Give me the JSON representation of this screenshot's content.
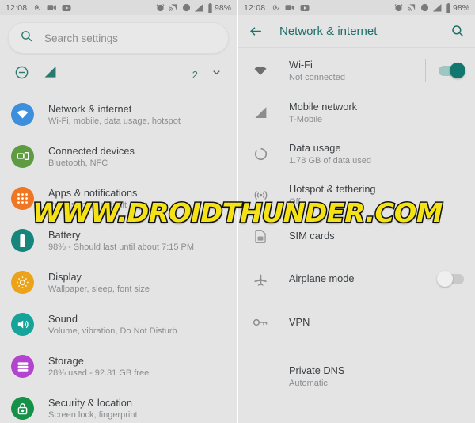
{
  "statusbar": {
    "time": "12:08",
    "battery_percent": "98%",
    "left_icons": [
      "screen-record-icon",
      "video-camera-icon",
      "youtube-icon"
    ],
    "right_icons": [
      "alarm-icon",
      "cast-icon",
      "do-not-disturb-icon",
      "signal-icon",
      "battery-icon"
    ]
  },
  "left": {
    "search": {
      "placeholder": "Search settings",
      "icon": "search-icon"
    },
    "quick": {
      "icons": [
        "do-not-disturb-icon",
        "signal-off-icon"
      ],
      "count": "2",
      "expand_icon": "chevron-down-icon"
    },
    "items": [
      {
        "title": "Network & internet",
        "sub": "Wi-Fi, mobile, data usage, hotspot",
        "icon": "wifi-icon",
        "color": "#3d8fdd",
        "name": "network-internet"
      },
      {
        "title": "Connected devices",
        "sub": "Bluetooth, NFC",
        "icon": "devices-icon",
        "color": "#5e9b41",
        "name": "connected-devices"
      },
      {
        "title": "Apps & notifications",
        "sub": "Permissions, default apps",
        "icon": "apps-grid-icon",
        "color": "#ef7622",
        "name": "apps-notifications"
      },
      {
        "title": "Battery",
        "sub": "98% - Should last until about 7:15 PM",
        "icon": "battery-icon",
        "color": "#16857c",
        "name": "battery"
      },
      {
        "title": "Display",
        "sub": "Wallpaper, sleep, font size",
        "icon": "brightness-icon",
        "color": "#eba31a",
        "name": "display"
      },
      {
        "title": "Sound",
        "sub": "Volume, vibration, Do Not Disturb",
        "icon": "volume-icon",
        "color": "#16a39a",
        "name": "sound"
      },
      {
        "title": "Storage",
        "sub": "28% used - 92.31 GB free",
        "icon": "storage-icon",
        "color": "#b344cf",
        "name": "storage"
      },
      {
        "title": "Security & location",
        "sub": "Screen lock, fingerprint",
        "icon": "lock-icon",
        "color": "#169148",
        "name": "security-location"
      }
    ]
  },
  "right": {
    "appbar": {
      "title": "Network & internet",
      "back_icon": "back-arrow-icon",
      "search_icon": "search-icon",
      "accent": "#1e6f68"
    },
    "items": [
      {
        "title": "Wi-Fi",
        "sub": "Not connected",
        "icon": "wifi-icon",
        "toggle": "on",
        "name": "wifi"
      },
      {
        "title": "Mobile network",
        "sub": "T-Mobile",
        "icon": "signal-icon",
        "toggle": null,
        "name": "mobile-network"
      },
      {
        "title": "Data usage",
        "sub": "1.78 GB of data used",
        "icon": "data-usage-icon",
        "toggle": null,
        "name": "data-usage"
      },
      {
        "title": "Hotspot & tethering",
        "sub": "Off",
        "icon": "hotspot-icon",
        "toggle": null,
        "name": "hotspot-tethering"
      },
      {
        "title": "SIM cards",
        "sub": "",
        "icon": "sim-card-icon",
        "toggle": null,
        "name": "sim-cards"
      },
      {
        "title": "Airplane mode",
        "sub": "",
        "icon": "airplane-icon",
        "toggle": "off",
        "name": "airplane-mode"
      },
      {
        "title": "VPN",
        "sub": "",
        "icon": "key-icon",
        "toggle": null,
        "name": "vpn"
      },
      {
        "title": "Private DNS",
        "sub": "Automatic",
        "icon": "",
        "toggle": null,
        "name": "private-dns"
      }
    ]
  },
  "watermark": {
    "text": "WWW.DROIDTHUNDER.COM",
    "color": "#f5e215",
    "outline": "#111111"
  }
}
